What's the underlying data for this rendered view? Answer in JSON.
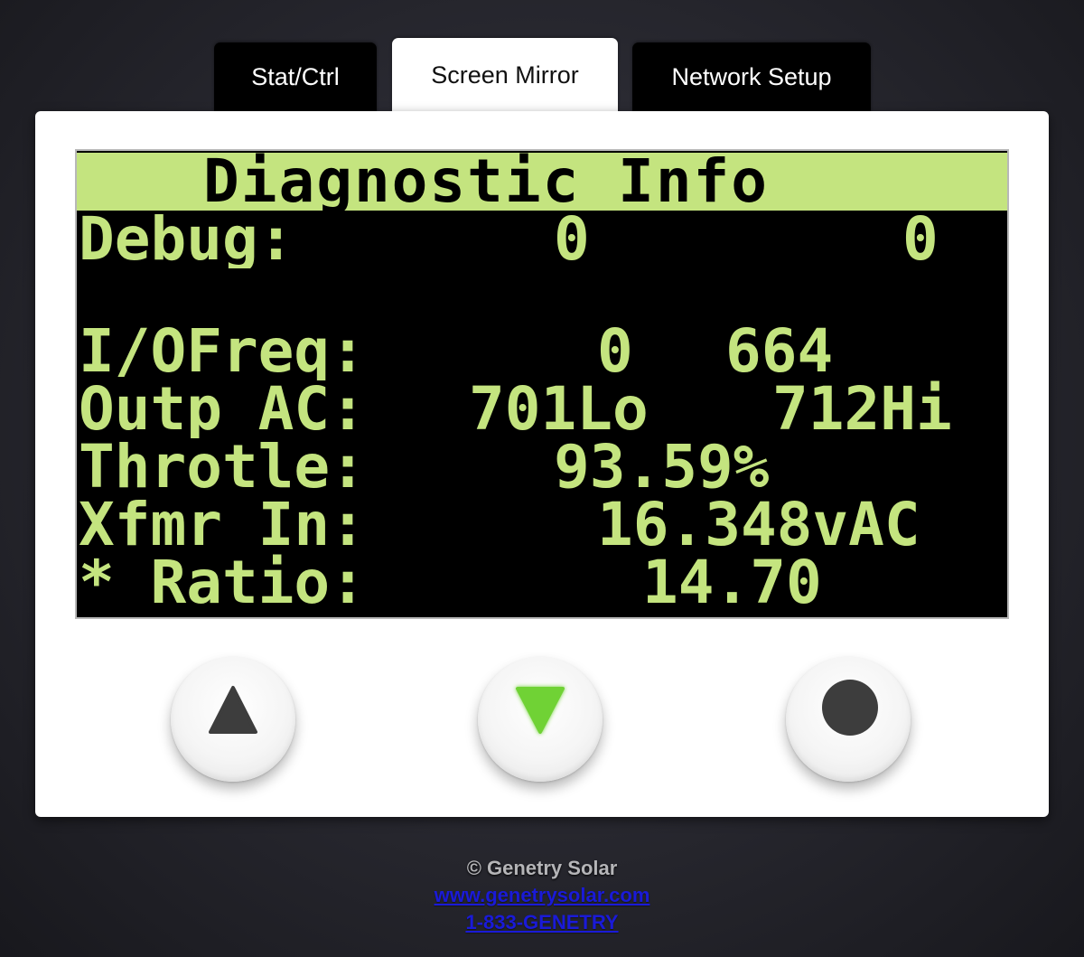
{
  "tabs": [
    {
      "label": "Stat/Ctrl",
      "active": false
    },
    {
      "label": "Screen Mirror",
      "active": true
    },
    {
      "label": "Network Setup",
      "active": false
    }
  ],
  "lcd": {
    "title": "Diagnostic Info",
    "rows": {
      "debug": {
        "label": "Debug:",
        "val1": "0",
        "val2": "0"
      },
      "blank": "",
      "io_freq": {
        "label": "I/OFreq:",
        "val1": "0",
        "val2": "664"
      },
      "outp_ac": {
        "label": "Outp AC:",
        "val1": "701Lo",
        "val2": "712Hi"
      },
      "throttle": {
        "label": "Throtle:",
        "val1": "93.59%"
      },
      "xfmr_in": {
        "label": "Xfmr In:",
        "val1": "16.348vAC"
      },
      "ratio": {
        "label": "* Ratio:",
        "val1": "14.70"
      }
    },
    "colors": {
      "text": "#c4e47f",
      "background": "#000000"
    }
  },
  "buttons": {
    "up": {
      "icon": "triangle-up-icon",
      "color": "#3d3d3d"
    },
    "down": {
      "icon": "triangle-down-icon",
      "color": "#6fd236"
    },
    "enter": {
      "icon": "circle-icon",
      "color": "#3d3d3d"
    }
  },
  "footer": {
    "copyright": "© Genetry Solar",
    "website": "www.genetrysolar.com",
    "phone": "1-833-GENETRY"
  }
}
